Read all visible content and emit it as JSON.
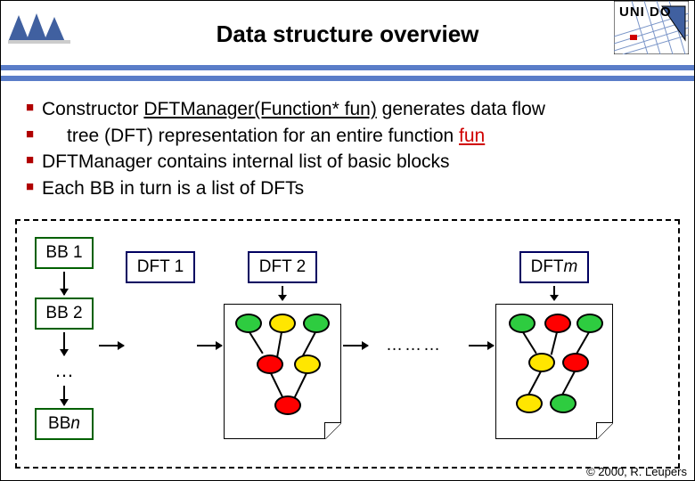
{
  "header": {
    "title": "Data structure overview",
    "logo_right_text": "UNI DO"
  },
  "bullets": {
    "b1a": "Constructor ",
    "b1b": "DFTManager(Function* fun)",
    "b1c": " generates data flow",
    "b1d": "tree (DFT) representation for an entire function ",
    "b1e": "fun",
    "b2": "DFTManager contains internal list of basic blocks",
    "b3": "Each BB in turn is a list of DFTs"
  },
  "diagram": {
    "bb1": "BB 1",
    "bb2": "BB 2",
    "bbn_prefix": "BB ",
    "bbn_suffix": "n",
    "dft1": "DFT 1",
    "dft2": "DFT 2",
    "dftm_prefix": "DFT ",
    "dftm_suffix": "m",
    "dots": "………",
    "ellipsis": "…"
  },
  "footer": {
    "copyright": "© 2000, R. Leupers"
  }
}
